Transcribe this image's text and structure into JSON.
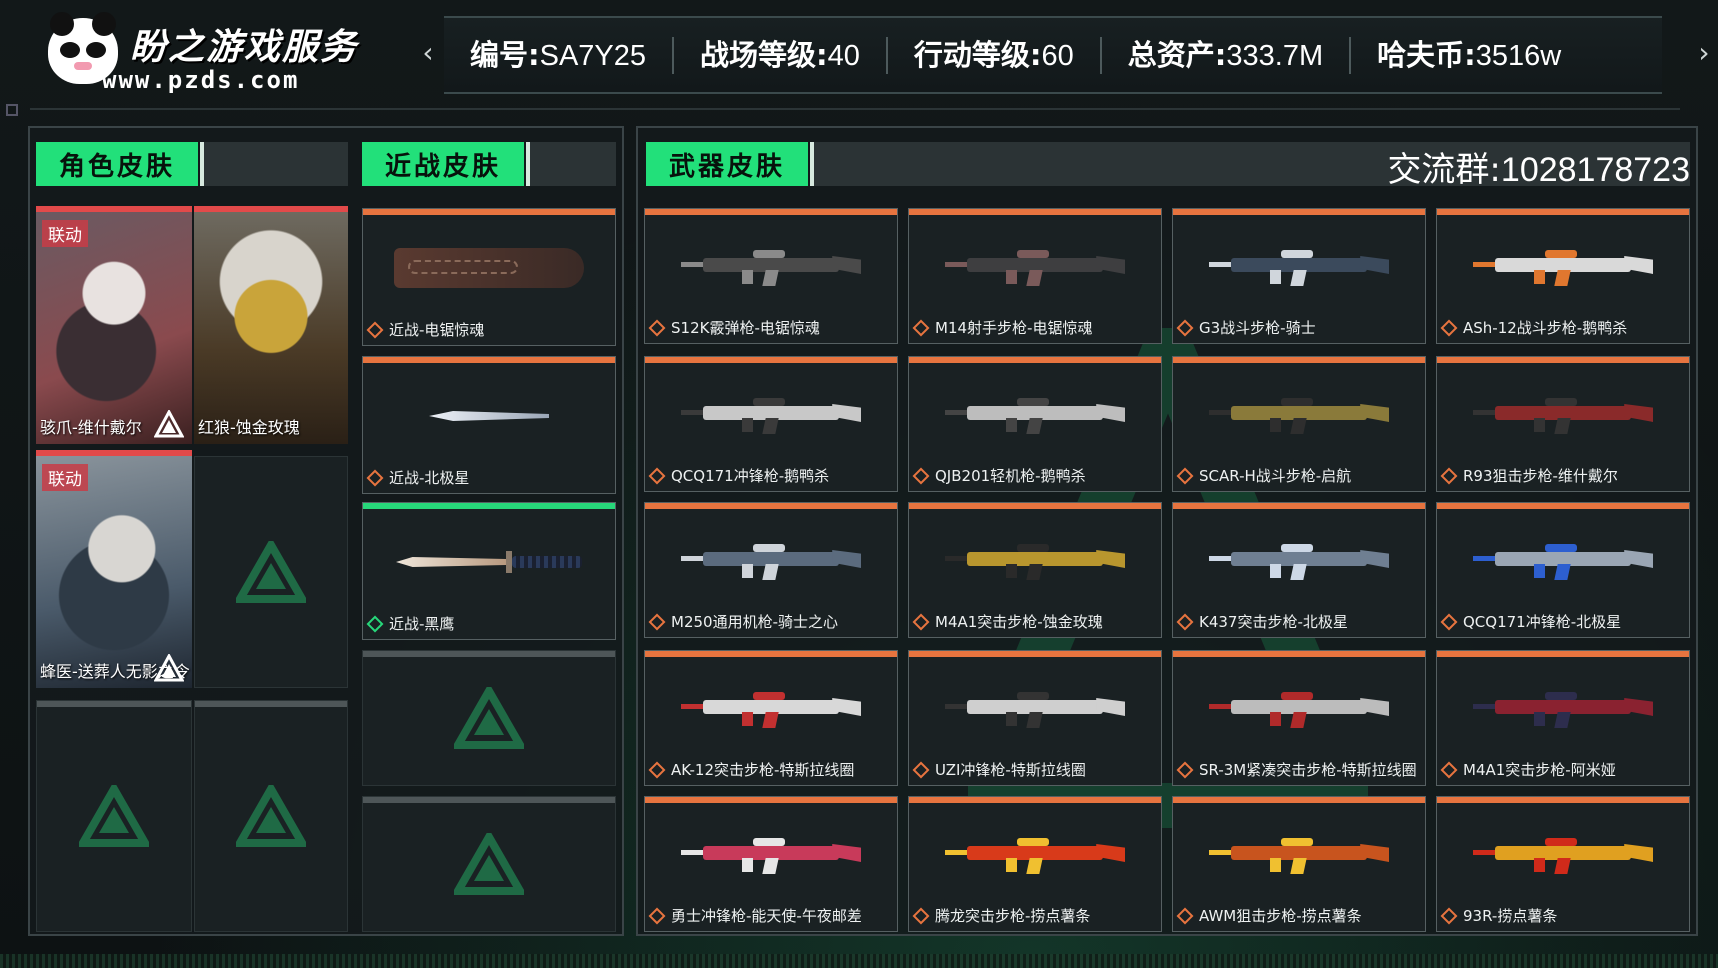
{
  "brand": {
    "title": "盼之游戏服务",
    "url": "www.pzds.com"
  },
  "stats": [
    {
      "label": "编号:",
      "value": "SA7Y25"
    },
    {
      "label": "战场等级:",
      "value": "40"
    },
    {
      "label": "行动等级:",
      "value": "60"
    },
    {
      "label": "总资产:",
      "value": "333.7M"
    },
    {
      "label": "哈夫币:",
      "value": "3516w"
    }
  ],
  "nav": {
    "prev": "‹",
    "next": "›"
  },
  "sections": {
    "character": {
      "tab": "角色皮肤"
    },
    "melee": {
      "tab": "近战皮肤"
    },
    "weapon": {
      "tab": "武器皮肤"
    }
  },
  "group_chat": {
    "label": "交流群:",
    "number": "1028178723"
  },
  "character_skins": [
    {
      "name": "骇爪-维什戴尔",
      "tag": "联动",
      "tone": "#8a4a4e"
    },
    {
      "name": "红狼-蚀金玫瑰",
      "tag": "",
      "tone": "#7a6430"
    },
    {
      "name": "蜂医-送葬人无影之令",
      "tag": "联动",
      "tone": "#4a5a6a"
    }
  ],
  "melee_skins": [
    {
      "name": "近战-电锯惊魂",
      "accent": "#6b3a34"
    },
    {
      "name": "近战-北极星",
      "accent": "#cfd8e6"
    },
    {
      "name": "近战-黑鹰",
      "accent": "#c9b29a"
    }
  ],
  "weapon_skins": [
    {
      "name": "S12K霰弹枪-电锯惊魂",
      "body": "#4a4a4a",
      "accent": "#8a8a8a"
    },
    {
      "name": "M14射手步枪-电锯惊魂",
      "body": "#3e3e40",
      "accent": "#7a5a5a"
    },
    {
      "name": "G3战斗步枪-骑士",
      "body": "#3b4a5c",
      "accent": "#d0d6dc"
    },
    {
      "name": "ASh-12战斗步枪-鹅鸭杀",
      "body": "#d9d9d9",
      "accent": "#e0772f"
    },
    {
      "name": "QCQ171冲锋枪-鹅鸭杀",
      "body": "#c8c8c8",
      "accent": "#3a3a3a"
    },
    {
      "name": "QJB201轻机枪-鹅鸭杀",
      "body": "#bdbdbd",
      "accent": "#444444"
    },
    {
      "name": "SCAR-H战斗步枪-启航",
      "body": "#8a7a3a",
      "accent": "#2e2e2e"
    },
    {
      "name": "R93狙击步枪-维什戴尔",
      "body": "#8a2a2a",
      "accent": "#333333"
    },
    {
      "name": "M250通用机枪-骑士之心",
      "body": "#5b6b7e",
      "accent": "#cfd4da"
    },
    {
      "name": "M4A1突击步枪-蚀金玫瑰",
      "body": "#b8962e",
      "accent": "#2a2a2a"
    },
    {
      "name": "K437突击步枪-北极星",
      "body": "#6f7f92",
      "accent": "#cdd8e6"
    },
    {
      "name": "QCQ171冲锋枪-北极星",
      "body": "#9aa6b4",
      "accent": "#2d5fd0"
    },
    {
      "name": "AK-12突击步枪-特斯拉线圈",
      "body": "#d8d8d8",
      "accent": "#c23030"
    },
    {
      "name": "UZI冲锋枪-特斯拉线圈",
      "body": "#cfcfcf",
      "accent": "#333333"
    },
    {
      "name": "SR-3M紧凑突击步枪-特斯拉线圈",
      "body": "#bcbcbc",
      "accent": "#b02a2a"
    },
    {
      "name": "M4A1突击步枪-阿米娅",
      "body": "#8a2230",
      "accent": "#2d2d4d"
    },
    {
      "name": "勇士冲锋枪-能天使-午夜邮差",
      "body": "#c83a5a",
      "accent": "#e6e6e6"
    },
    {
      "name": "腾龙突击步枪-捞点薯条",
      "body": "#d83a1a",
      "accent": "#f0c030"
    },
    {
      "name": "AWM狙击步枪-捞点薯条",
      "body": "#c8541e",
      "accent": "#f0c030"
    },
    {
      "name": "93R-捞点薯条",
      "body": "#e0a020",
      "accent": "#d02a1a"
    }
  ]
}
